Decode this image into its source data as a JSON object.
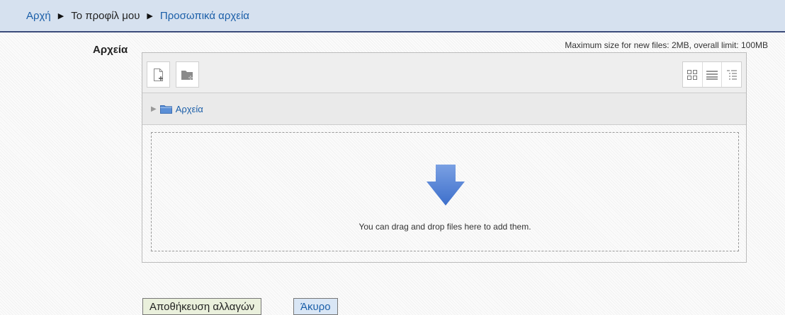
{
  "breadcrumb": {
    "items": [
      "Αρχή",
      "Το προφίλ μου",
      "Προσωπικά αρχεία"
    ],
    "separator": "▶"
  },
  "form": {
    "field_label": "Αρχεία",
    "limit_text": "Maximum size for new files: 2MB, overall limit: 100MB"
  },
  "filemanager": {
    "toolbar": {
      "add_file_icon": "add-file-icon",
      "create_folder_icon": "create-folder-icon",
      "views": [
        "icon-view",
        "list-view",
        "tree-view"
      ]
    },
    "path": {
      "folder_name": "Αρχεία"
    },
    "dropzone_text": "You can drag and drop files here to add them."
  },
  "buttons": {
    "save": "Αποθήκευση αλλαγών",
    "cancel": "Άκυρο"
  },
  "colors": {
    "link": "#1a5ea8",
    "breadcrumb_bg": "#d6e1ef",
    "drop_arrow": "#4f7fd6"
  }
}
